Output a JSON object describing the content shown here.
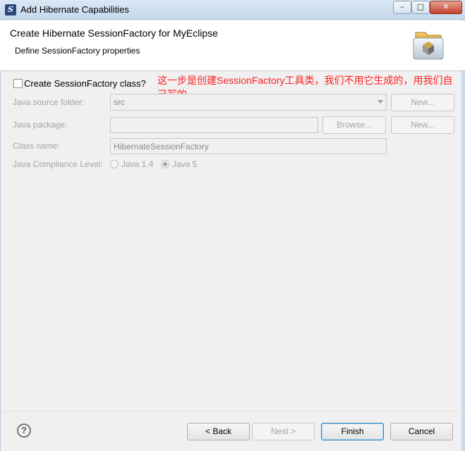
{
  "window": {
    "title": "Add Hibernate Capabilities",
    "minimize_glyph": "–",
    "maximize_glyph": "□",
    "close_glyph": "✕"
  },
  "header": {
    "title": "Create Hibernate SessionFactory for MyEclipse",
    "subtitle": "Define SessionFactory properties"
  },
  "form": {
    "create_class_label": "Create SessionFactory class?",
    "create_class_checked": false,
    "annotation": "这一步是创建SessionFactory工具类，我们不用它生成的，用我们自己写的",
    "source_folder_label": "Java source folder:",
    "source_folder_value": "src",
    "new_folder_button": "New...",
    "package_label": "Java package:",
    "package_value": "",
    "browse_button": "Browse...",
    "new_package_button": "New...",
    "class_name_label": "Class name:",
    "class_name_value": "HibernateSessionFactory",
    "compliance_label": "Java Compliance Level:",
    "compliance_options": [
      "Java 1.4",
      "Java 5"
    ],
    "compliance_selected": "Java 5"
  },
  "footer": {
    "help_glyph": "?",
    "back_button": "< Back",
    "next_button": "Next >",
    "finish_button": "Finish",
    "cancel_button": "Cancel"
  }
}
